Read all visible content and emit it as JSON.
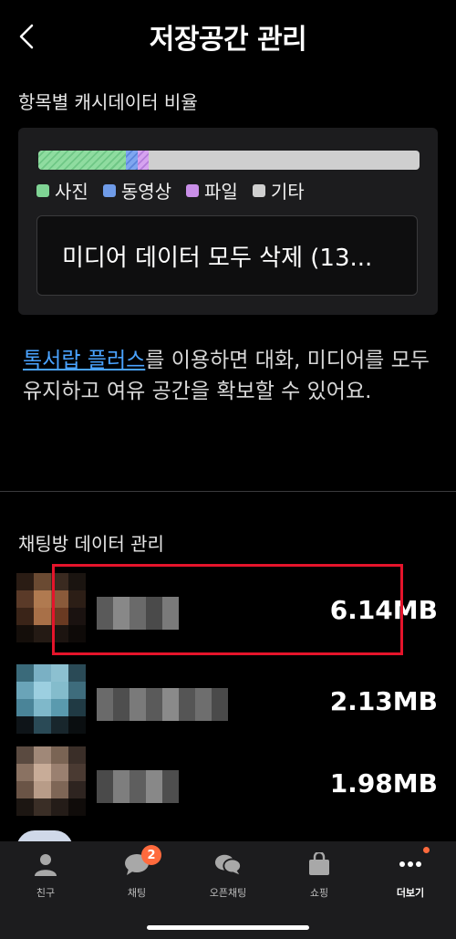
{
  "header": {
    "title": "저장공간 관리"
  },
  "cache": {
    "section_title": "항목별 캐시데이터 비율",
    "ratios": {
      "photo": 0.23,
      "video": 0.03,
      "file": 0.03,
      "other": 0.71
    },
    "legend": [
      {
        "label": "사진",
        "color": "#7fd394"
      },
      {
        "label": "동영상",
        "color": "#6f9be8"
      },
      {
        "label": "파일",
        "color": "#c98fe8"
      },
      {
        "label": "기타",
        "color": "#cfcfcf"
      }
    ],
    "delete_label": "미디어 데이터 모두 삭제 (13..."
  },
  "promo": {
    "link": "톡서랍 플러스",
    "text": "를 이용하면 대화, 미디어를 모두 유지하고 여유 공간을 확보할 수 있어요."
  },
  "chats": {
    "section_title": "채팅방 데이터 관리",
    "rows": [
      {
        "size": "6.14MB"
      },
      {
        "size": "2.13MB"
      },
      {
        "size": "1.98MB"
      }
    ]
  },
  "tabbar": {
    "items": [
      {
        "label": "친구",
        "icon": "person-icon"
      },
      {
        "label": "채팅",
        "icon": "chat-icon",
        "badge": "2"
      },
      {
        "label": "오픈채팅",
        "icon": "open-chat-icon"
      },
      {
        "label": "쇼핑",
        "icon": "shopping-bag-icon"
      },
      {
        "label": "더보기",
        "icon": "more-icon"
      }
    ]
  }
}
